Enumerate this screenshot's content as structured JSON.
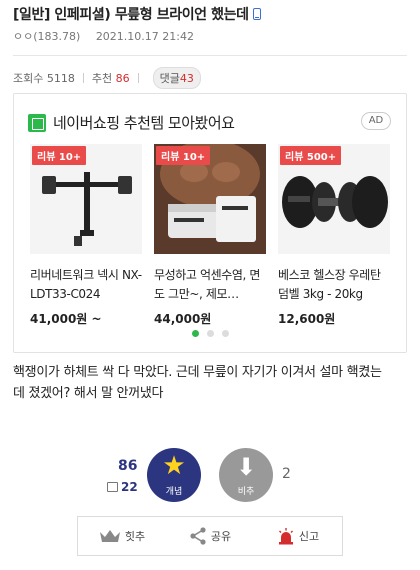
{
  "post": {
    "title": "[일반] 인페피셜) 무릎형 브라이언 했는데",
    "author": "ㅇㅇ(183.78)",
    "date": "2021.10.17 21:42",
    "views_label": "조회수",
    "views": "5118",
    "recommend_label": "추천",
    "recommend": "86",
    "comment_label": "댓글",
    "comments": "43",
    "body_line1": "핵쟁이가 하체트 싹 다 막았다. 근데 무릎이 자기가 이겨서 설마 핵켰는",
    "body_line2": "데 졌겠어? 해서 말 안꺼냈다"
  },
  "ad": {
    "title": "네이버쇼핑 추천템 모아봤어요",
    "badge": "AD",
    "products": [
      {
        "review": "리뷰 10+",
        "name": "리버네트워크 넥시 NX-LDT33-C024",
        "price": "41,000원 ~"
      },
      {
        "review": "리뷰 10+",
        "name": "무성하고 억센수염, 면도 그만~, 제모…",
        "price": "44,000원"
      },
      {
        "review": "리뷰 500+",
        "name": "베스코 헬스장 우레탄 덤벨 3kg - 20kg",
        "price": "12,600원"
      }
    ],
    "carousel_active_index": 0,
    "colors": {
      "shop_green": "#2db84c",
      "review_red": "#e94a4a"
    }
  },
  "votes": {
    "up_count": "86",
    "fix_count": "22",
    "up_label": "개념",
    "down_label": "비추",
    "down_count": "2",
    "colors": {
      "up": "#2c3580",
      "down": "#999999",
      "star": "#ffd21f"
    }
  },
  "actions": {
    "hit": "힛추",
    "share": "공유",
    "report": "신고"
  }
}
